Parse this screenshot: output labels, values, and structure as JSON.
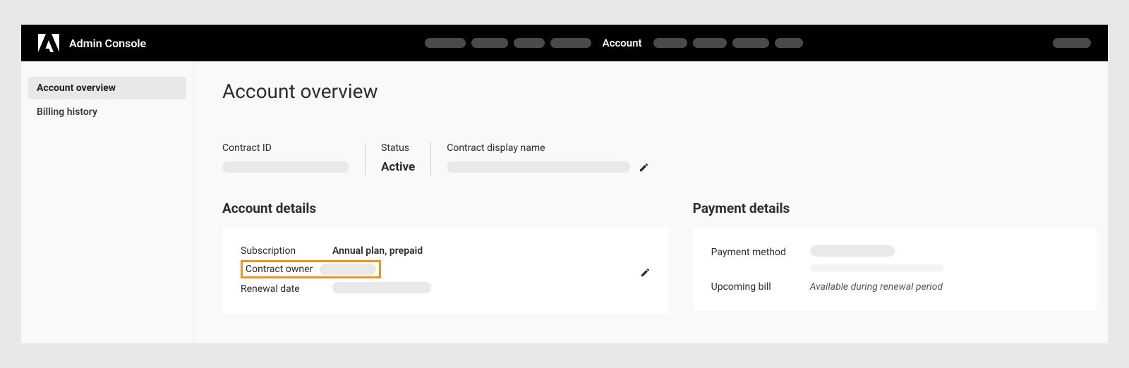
{
  "header": {
    "app_title": "Admin Console",
    "active_nav": "Account"
  },
  "sidebar": {
    "items": [
      {
        "label": "Account overview",
        "active": true
      },
      {
        "label": "Billing history",
        "active": false
      }
    ]
  },
  "page": {
    "title": "Account overview",
    "contract": {
      "id_label": "Contract ID",
      "status_label": "Status",
      "status_value": "Active",
      "display_name_label": "Contract display name"
    },
    "account_details": {
      "section_title": "Account details",
      "subscription_label": "Subscription",
      "subscription_value": "Annual plan, prepaid",
      "contract_owner_label": "Contract owner",
      "renewal_date_label": "Renewal date"
    },
    "payment_details": {
      "section_title": "Payment details",
      "payment_method_label": "Payment method",
      "upcoming_bill_label": "Upcoming bill",
      "upcoming_bill_value": "Available during renewal period"
    }
  }
}
